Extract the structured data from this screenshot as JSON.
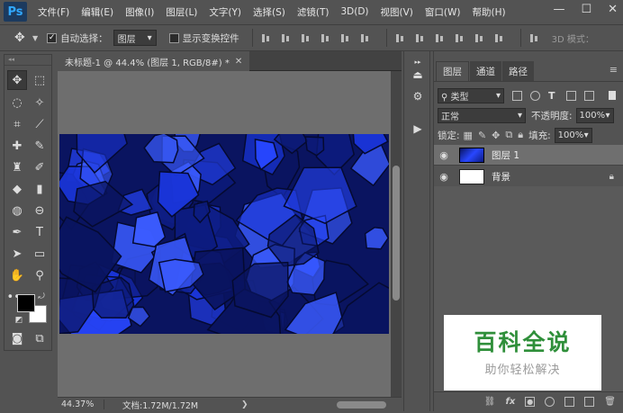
{
  "app": {
    "logo": "Ps"
  },
  "menu": [
    "文件(F)",
    "编辑(E)",
    "图像(I)",
    "图层(L)",
    "文字(Y)",
    "选择(S)",
    "滤镜(T)",
    "3D(D)",
    "视图(V)",
    "窗口(W)",
    "帮助(H)"
  ],
  "window_controls": {
    "minimize": "—",
    "maximize": "☐",
    "close": "✕"
  },
  "options": {
    "auto_select_label": "自动选择：",
    "auto_select_checked": true,
    "auto_select_target": "图层",
    "show_transform_label": "显示变换控件",
    "show_transform_checked": false,
    "mode_3d_label": "3D 模式："
  },
  "document": {
    "tab_title": "未标题-1 @ 44.4% (图层 1, RGB/8#) *",
    "zoom": "44.37%",
    "doc_info": "文档:1.72M/1.72M",
    "canvas_colors": [
      "#0a1460",
      "#1a35d8",
      "#2847ff",
      "#0d1c80",
      "#3b5cff"
    ]
  },
  "layers_panel": {
    "tabs": [
      "图层",
      "通道",
      "路径"
    ],
    "filter_kind": "类型",
    "blend_mode": "正常",
    "opacity_label": "不透明度:",
    "opacity": "100%",
    "lock_label": "锁定:",
    "fill_label": "填充:",
    "fill": "100%",
    "layers": [
      {
        "name": "图层 1",
        "selected": true,
        "thumb": "#1a35d8",
        "locked": false
      },
      {
        "name": "背景",
        "selected": false,
        "thumb": "#ffffff",
        "locked": true
      }
    ],
    "bottom_icons": [
      "link-icon",
      "fx-icon",
      "mask-icon",
      "adjustment-icon",
      "folder-icon",
      "new-layer-icon",
      "trash-icon"
    ]
  },
  "watermark": {
    "title": "百科全说",
    "subtitle": "助你轻松解决"
  }
}
